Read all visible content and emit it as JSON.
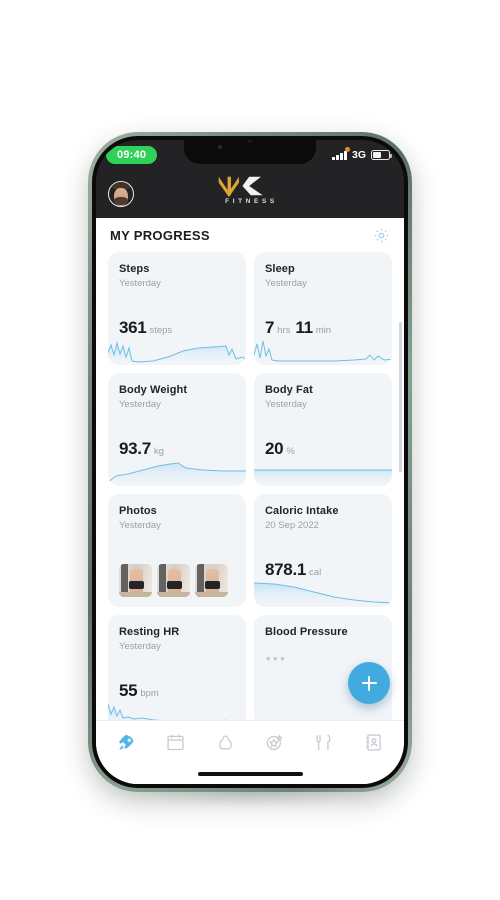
{
  "status_bar": {
    "time": "09:40",
    "network": "3G",
    "battery_level_pct": 55,
    "signal_bars": 4
  },
  "app_header": {
    "logo_main": "MK",
    "logo_sub": "FITNESS",
    "avatar_alt": "user-avatar"
  },
  "title_bar": {
    "title": "MY PROGRESS",
    "settings_icon": "gear-icon"
  },
  "colors": {
    "accent_blue": "#41abe0",
    "card_bg": "#f2f5f8",
    "logo_gold": "#e0a431",
    "status_green": "#30d158",
    "spark_line": "#6fbfe8"
  },
  "cards": [
    {
      "id": "steps",
      "title": "Steps",
      "subtitle": "Yesterday",
      "value": "361",
      "unit": "steps",
      "value2": "",
      "unit2": "",
      "has_sparkline": true
    },
    {
      "id": "sleep",
      "title": "Sleep",
      "subtitle": "Yesterday",
      "value": "7",
      "unit": "hrs",
      "value2": "11",
      "unit2": "min",
      "has_sparkline": true
    },
    {
      "id": "body-weight",
      "title": "Body Weight",
      "subtitle": "Yesterday",
      "value": "93.7",
      "unit": "kg",
      "value2": "",
      "unit2": "",
      "has_sparkline": true
    },
    {
      "id": "body-fat",
      "title": "Body Fat",
      "subtitle": "Yesterday",
      "value": "20",
      "unit": "%",
      "value2": "",
      "unit2": "",
      "has_sparkline": true
    },
    {
      "id": "photos",
      "title": "Photos",
      "subtitle": "Yesterday",
      "value": "",
      "unit": "",
      "value2": "",
      "unit2": "",
      "has_sparkline": false,
      "photo_count": 3
    },
    {
      "id": "caloric-intake",
      "title": "Caloric Intake",
      "subtitle": "20 Sep 2022",
      "value": "878.1",
      "unit": "cal",
      "value2": "",
      "unit2": "",
      "has_sparkline": true
    },
    {
      "id": "resting-hr",
      "title": "Resting HR",
      "subtitle": "Yesterday",
      "value": "55",
      "unit": "bpm",
      "value2": "",
      "unit2": "",
      "has_sparkline": true
    },
    {
      "id": "blood-pressure",
      "title": "Blood Pressure",
      "subtitle": "",
      "placeholder": "•••",
      "value": "",
      "unit": "",
      "value2": "",
      "unit2": "",
      "has_sparkline": false
    }
  ],
  "fab": {
    "label": "+",
    "name": "add-entry-button"
  },
  "tab_bar": {
    "active_index": 0,
    "items": [
      {
        "name": "tab-dashboard",
        "icon": "rocket-icon"
      },
      {
        "name": "tab-calendar",
        "icon": "calendar-icon"
      },
      {
        "name": "tab-workouts",
        "icon": "kettlebell-icon"
      },
      {
        "name": "tab-achievements",
        "icon": "star-badge-icon"
      },
      {
        "name": "tab-nutrition",
        "icon": "fork-knife-icon"
      },
      {
        "name": "tab-contacts",
        "icon": "contact-card-icon"
      }
    ]
  }
}
